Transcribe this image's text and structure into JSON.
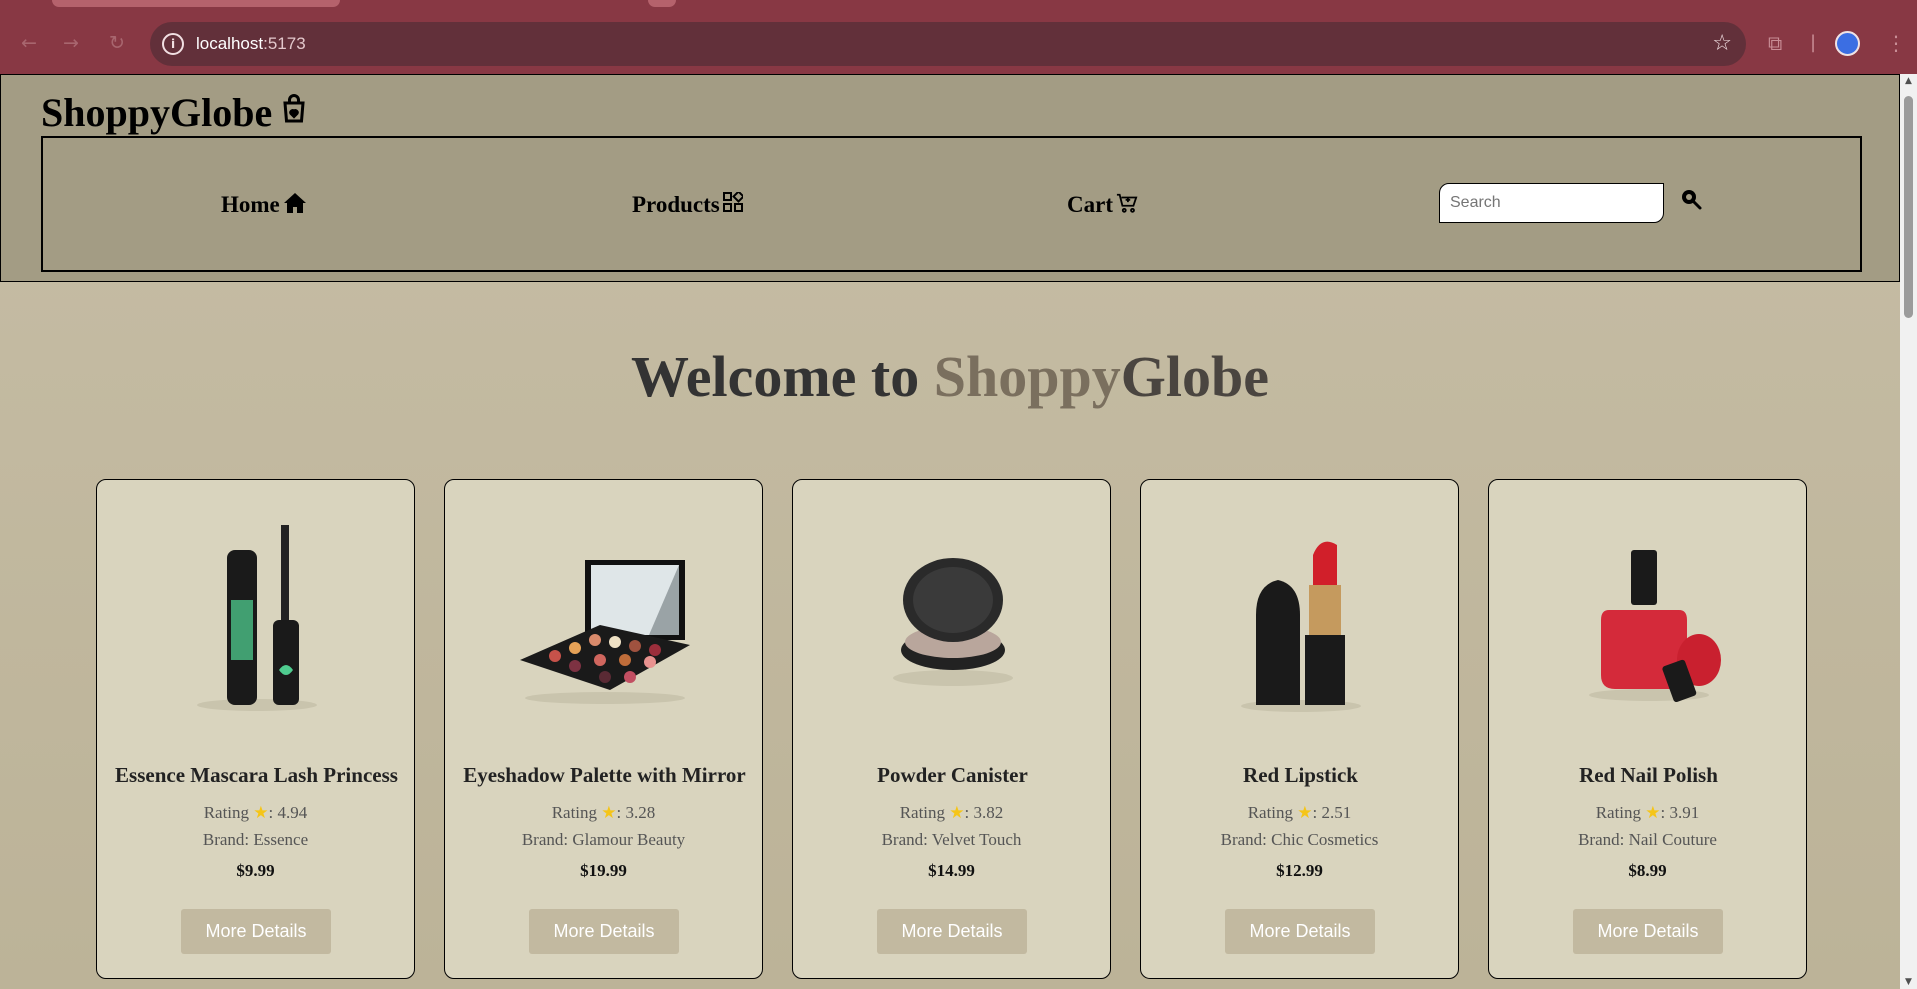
{
  "browser": {
    "url_host": "localhost",
    "url_port": ":5173"
  },
  "header": {
    "logo": "ShoppyGlobe",
    "nav": {
      "home": "Home",
      "products": "Products",
      "cart": "Cart"
    },
    "search_placeholder": "Search"
  },
  "hero": {
    "prefix": "Welcome to ",
    "shoppy": "Shoppy",
    "globe": "Globe"
  },
  "products": [
    {
      "title": "Essence Mascara Lash Princess",
      "rating_label": "Rating",
      "rating": ": 4.94",
      "brand": "Brand: Essence",
      "price": "$9.99",
      "button": "More Details",
      "image": "mascara-icon"
    },
    {
      "title": "Eyeshadow Palette with Mirror",
      "rating_label": "Rating",
      "rating": ": 3.28",
      "brand": "Brand: Glamour Beauty",
      "price": "$19.99",
      "button": "More Details",
      "image": "eyeshadow-palette-icon"
    },
    {
      "title": "Powder Canister",
      "rating_label": "Rating",
      "rating": ": 3.82",
      "brand": "Brand: Velvet Touch",
      "price": "$14.99",
      "button": "More Details",
      "image": "powder-canister-icon"
    },
    {
      "title": "Red Lipstick",
      "rating_label": "Rating",
      "rating": ": 2.51",
      "brand": "Brand: Chic Cosmetics",
      "price": "$12.99",
      "button": "More Details",
      "image": "lipstick-icon"
    },
    {
      "title": "Red Nail Polish",
      "rating_label": "Rating",
      "rating": ": 3.91",
      "brand": "Brand: Nail Couture",
      "price": "$8.99",
      "button": "More Details",
      "image": "nail-polish-icon"
    }
  ]
}
